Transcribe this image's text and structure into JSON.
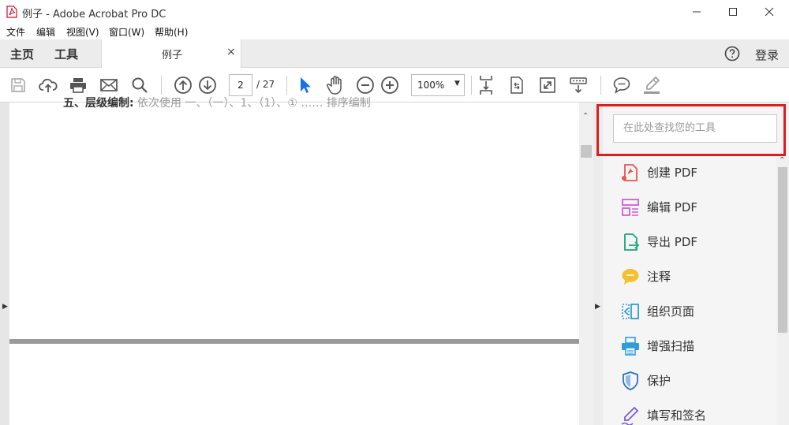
{
  "window": {
    "title": "例子 - Adobe Acrobat Pro DC"
  },
  "menu": [
    "文件",
    "编辑",
    "视图(V)",
    "窗口(W)",
    "帮助(H)"
  ],
  "tabs": {
    "home": "主页",
    "tools": "工具",
    "document": "例子",
    "close": "×"
  },
  "header": {
    "login": "登录"
  },
  "toolbar": {
    "page_current": "2",
    "page_total": "/ 27",
    "zoom": "100%"
  },
  "document": {
    "visible_fragment_bold": "五、层级编制:",
    "visible_fragment_rest": " 依次使用 一、（一）、1、（1）、① …… 排序编制"
  },
  "tools_panel": {
    "search_placeholder": "在此处查找您的工具",
    "items": [
      {
        "label": "创建 PDF",
        "icon": "create-pdf-icon",
        "color": "#e8554e"
      },
      {
        "label": "编辑 PDF",
        "icon": "edit-pdf-icon",
        "color": "#d35bd5"
      },
      {
        "label": "导出 PDF",
        "icon": "export-pdf-icon",
        "color": "#1fa37a"
      },
      {
        "label": "注释",
        "icon": "comment-icon",
        "color": "#f3c12d"
      },
      {
        "label": "组织页面",
        "icon": "organize-pages-icon",
        "color": "#2f9ed8"
      },
      {
        "label": "增强扫描",
        "icon": "enhance-scan-icon",
        "color": "#2f9ed8"
      },
      {
        "label": "保护",
        "icon": "protect-icon",
        "color": "#2b6fc7"
      },
      {
        "label": "填写和签名",
        "icon": "fill-sign-icon",
        "color": "#7e5bd6"
      }
    ]
  },
  "colors": {
    "highlight": "#d9201f",
    "accent": "#1473e6"
  }
}
